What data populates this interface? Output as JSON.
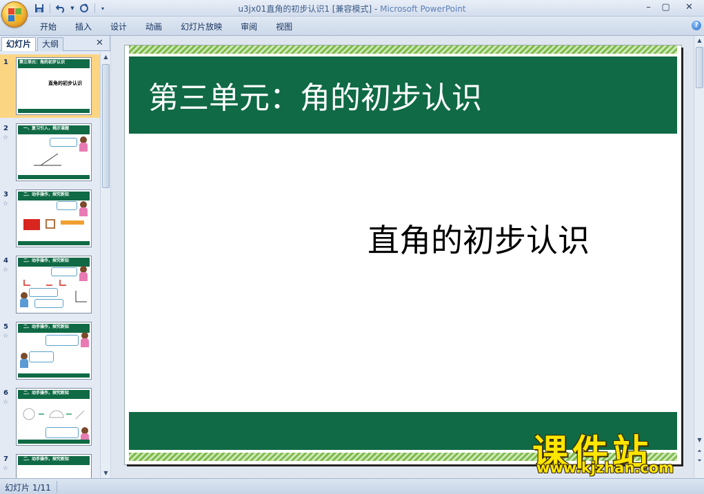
{
  "window": {
    "title": "u3jx01直角的初步认识1 [兼容模式]",
    "separator": " - ",
    "app_name": "Microsoft PowerPoint",
    "minimize": "–",
    "maximize": "▢",
    "close": "✕"
  },
  "quick_access": {
    "save_icon": "save-icon",
    "undo_icon": "undo-icon",
    "redo_icon": "redo-icon"
  },
  "ribbon": {
    "tabs": [
      "开始",
      "插入",
      "设计",
      "动画",
      "幻灯片放映",
      "审阅",
      "视图"
    ],
    "help": "?"
  },
  "left_panel": {
    "tab_slides": "幻灯片",
    "tab_outline": "大纲",
    "close": "✕",
    "thumbnails": [
      {
        "num": "1",
        "header": "第三单元：角的初步认识",
        "subtitle": "直角的初步认识",
        "selected": true
      },
      {
        "num": "2",
        "header": "一、复习引入，揭示课题"
      },
      {
        "num": "3",
        "header": "二、动手操作，探究新知"
      },
      {
        "num": "4",
        "header": "二、动手操作，探究新知"
      },
      {
        "num": "5",
        "header": "二、动手操作，探究新知"
      },
      {
        "num": "6",
        "header": "二、动手操作，探究新知"
      },
      {
        "num": "7",
        "header": "二、动手操作，探究新知"
      }
    ]
  },
  "slide": {
    "title": "第三单元：角的初步认识",
    "subtitle": "直角的初步认识",
    "band_color": "#0f6a45"
  },
  "status": {
    "slide_info": "幻灯片 1/11"
  },
  "watermark": {
    "site_name": "课件站",
    "url": "www.kjzhan.com"
  }
}
